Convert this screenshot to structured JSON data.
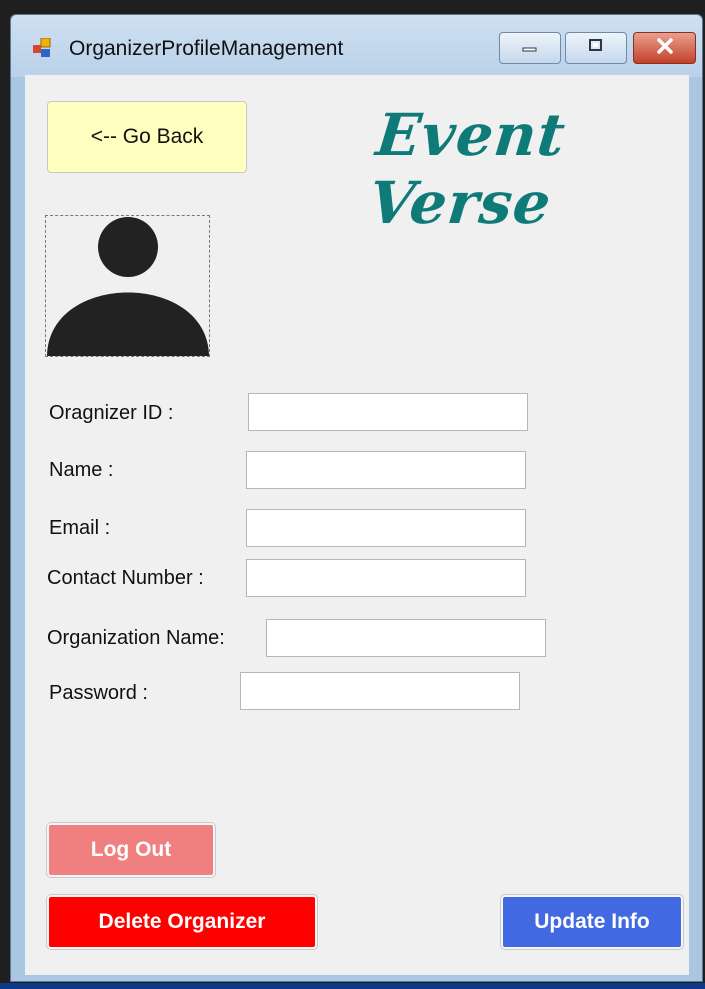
{
  "window": {
    "title": "OrganizerProfileManagement"
  },
  "header": {
    "go_back_label": "<-- Go Back",
    "brand": "Event Verse"
  },
  "form": {
    "organizer_id_label": "Oragnizer ID :",
    "organizer_id_value": "",
    "name_label": "Name :",
    "name_value": "",
    "email_label": "Email :",
    "email_value": "",
    "contact_label": "Contact Number :",
    "contact_value": "",
    "organization_label": "Organization Name:",
    "organization_value": "",
    "password_label": "Password :",
    "password_value": ""
  },
  "actions": {
    "logout_label": "Log Out",
    "delete_label": "Delete Organizer",
    "update_label": "Update Info"
  },
  "colors": {
    "go_back_bg": "#ffffc0",
    "brand_color": "#0f7b78",
    "logout_bg": "#f08080",
    "delete_bg": "#ff0000",
    "update_bg": "#4169e1"
  },
  "icons": {
    "app": "form-app-icon",
    "avatar": "user-avatar-icon",
    "minimize": "minimize-icon",
    "maximize": "maximize-icon",
    "close": "close-icon"
  }
}
